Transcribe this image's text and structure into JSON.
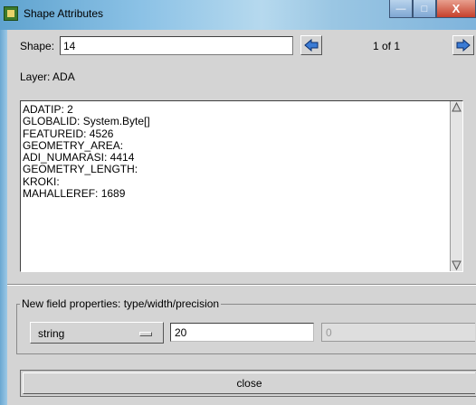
{
  "window": {
    "title": "Shape Attributes",
    "minimize_glyph": "—",
    "maximize_glyph": "□",
    "close_glyph": "X"
  },
  "shape": {
    "label": "Shape:",
    "value": "14",
    "page_indicator": "1 of 1",
    "prev_icon": "arrow-left-icon",
    "next_icon": "arrow-right-icon"
  },
  "layer": {
    "label": "Layer: ADA"
  },
  "attributes": [
    "ADATIP: 2",
    "GLOBALID: System.Byte[]",
    "FEATUREID: 4526",
    "GEOMETRY_AREA:",
    "ADI_NUMARASI: 4414",
    "GEOMETRY_LENGTH:",
    "KROKI:",
    "MAHALLEREF: 1689"
  ],
  "new_field": {
    "group_title": "New field properties: type/width/precision",
    "type": "string",
    "width": "20",
    "precision": "0"
  },
  "actions": {
    "close_label": "close"
  },
  "colors": {
    "arrow_fill": "#3a7bd5",
    "window_bg": "#d4d4d4"
  }
}
